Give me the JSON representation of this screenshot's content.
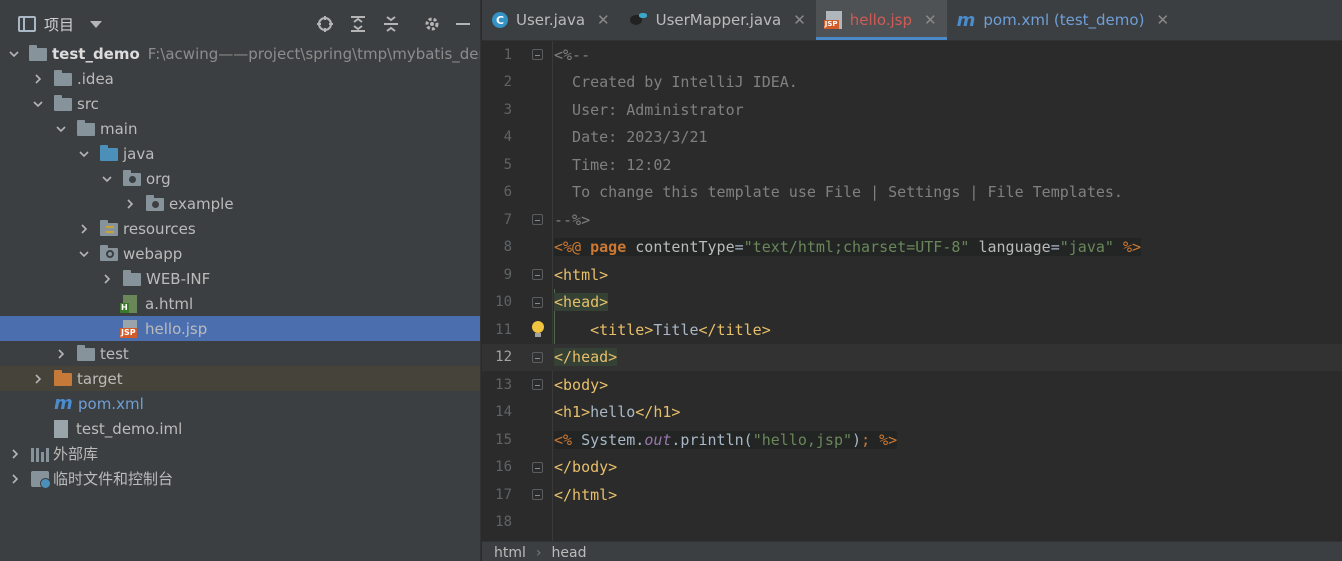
{
  "project_panel": {
    "title": "项目",
    "tree": [
      {
        "label": "test_demo",
        "path": "F:\\acwing——project\\spring\\tmp\\mybatis_demo",
        "depth": 0,
        "chevron": "open",
        "icon": "module-folder",
        "style": "bold"
      },
      {
        "label": ".idea",
        "depth": 1,
        "chevron": "closed",
        "icon": "folder"
      },
      {
        "label": "src",
        "depth": 1,
        "chevron": "open",
        "icon": "folder"
      },
      {
        "label": "main",
        "depth": 2,
        "chevron": "open",
        "icon": "folder"
      },
      {
        "label": "java",
        "depth": 3,
        "chevron": "open",
        "icon": "source-folder"
      },
      {
        "label": "org",
        "depth": 4,
        "chevron": "open",
        "icon": "package-folder"
      },
      {
        "label": "example",
        "depth": 5,
        "chevron": "closed",
        "icon": "package-folder"
      },
      {
        "label": "resources",
        "depth": 3,
        "chevron": "closed",
        "icon": "resources-folder"
      },
      {
        "label": "webapp",
        "depth": 3,
        "chevron": "open",
        "icon": "web-folder"
      },
      {
        "label": "WEB-INF",
        "depth": 4,
        "chevron": "closed",
        "icon": "folder"
      },
      {
        "label": "a.html",
        "depth": 4,
        "chevron": "none",
        "icon": "html-file"
      },
      {
        "label": "hello.jsp",
        "depth": 4,
        "chevron": "none",
        "icon": "jsp-file",
        "selected": true
      },
      {
        "label": "test",
        "depth": 2,
        "chevron": "closed",
        "icon": "folder"
      },
      {
        "label": "target",
        "depth": 1,
        "chevron": "closed",
        "icon": "excluded-folder",
        "excluded": true
      },
      {
        "label": "pom.xml",
        "depth": 1,
        "chevron": "none",
        "icon": "maven-file",
        "style": "blue"
      },
      {
        "label": "test_demo.iml",
        "depth": 1,
        "chevron": "none",
        "icon": "iml-file"
      },
      {
        "label": "外部库",
        "depth": 0,
        "chevron": "closed",
        "icon": "library"
      },
      {
        "label": "临时文件和控制台",
        "depth": 0,
        "chevron": "closed",
        "icon": "scratch"
      }
    ]
  },
  "tabs": [
    {
      "label": "User.java",
      "icon": "class-icon",
      "active": false,
      "style": "normal"
    },
    {
      "label": "UserMapper.java",
      "icon": "mybatis-icon",
      "active": false,
      "style": "normal"
    },
    {
      "label": "hello.jsp",
      "icon": "jsp-icon",
      "active": true,
      "style": "red"
    },
    {
      "label": "pom.xml (test_demo)",
      "icon": "maven-icon",
      "active": false,
      "style": "blue"
    }
  ],
  "editor": {
    "current_line": 12,
    "lines": [
      {
        "n": "1",
        "html": "<span class='c-comment'>&lt;%--</span>",
        "fold": true
      },
      {
        "n": "2",
        "html": "<span class='c-comment'>  Created by IntelliJ IDEA.</span>"
      },
      {
        "n": "3",
        "html": "<span class='c-comment'>  User: Administrator</span>"
      },
      {
        "n": "4",
        "html": "<span class='c-comment'>  Date: 2023/3/21</span>"
      },
      {
        "n": "5",
        "html": "<span class='c-comment'>  Time: 12:02</span>"
      },
      {
        "n": "6",
        "html": "<span class='c-comment'>  To change this template use File | Settings | File Templates.</span>"
      },
      {
        "n": "7",
        "html": "<span class='c-comment'>--%&gt;</span>",
        "fold": true
      },
      {
        "n": "8",
        "html": "<span class='jsp-bg'><span class='c-jsp'>&lt;%@ </span><span class='c-kw'>page </span><span class='c-attr'>contentType</span>=<span class='c-str'>\"text/html;charset=UTF-8\"</span> <span class='c-attr'>language</span>=<span class='c-str'>\"java\"</span> <span class='c-jsp'>%&gt;</span></span>"
      },
      {
        "n": "9",
        "html": "<span class='c-tag'>&lt;html&gt;</span>",
        "fold": true
      },
      {
        "n": "10",
        "html": "<span class='hl-bg c-tag'>&lt;head&gt;</span>",
        "fold": true
      },
      {
        "n": "11",
        "html": "    <span class='c-tag'>&lt;title&gt;</span>Title<span class='c-tag'>&lt;/title&gt;</span>",
        "bulb": true
      },
      {
        "n": "12",
        "html": "<span class='hl-bg c-tag'>&lt;/head&gt;</span>",
        "fold": true
      },
      {
        "n": "13",
        "html": "<span class='c-tag'>&lt;body&gt;</span>",
        "fold": true
      },
      {
        "n": "14",
        "html": "<span class='c-tag'>&lt;h1&gt;</span>hello<span class='c-tag'>&lt;/h1&gt;</span>"
      },
      {
        "n": "15",
        "html": "<span class='jsp-bg'><span class='c-jsp'>&lt;% </span>System.<span class='c-field'>out</span>.println(<span class='c-str'>\"hello,jsp\"</span>)<span class='c-jsp'>; %&gt;</span></span>"
      },
      {
        "n": "16",
        "html": "<span class='c-tag'>&lt;/body&gt;</span>",
        "fold": true
      },
      {
        "n": "17",
        "html": "<span class='c-tag'>&lt;/html&gt;</span>",
        "fold": true
      },
      {
        "n": "18",
        "html": ""
      }
    ]
  },
  "breadcrumb": [
    "html",
    "head"
  ]
}
